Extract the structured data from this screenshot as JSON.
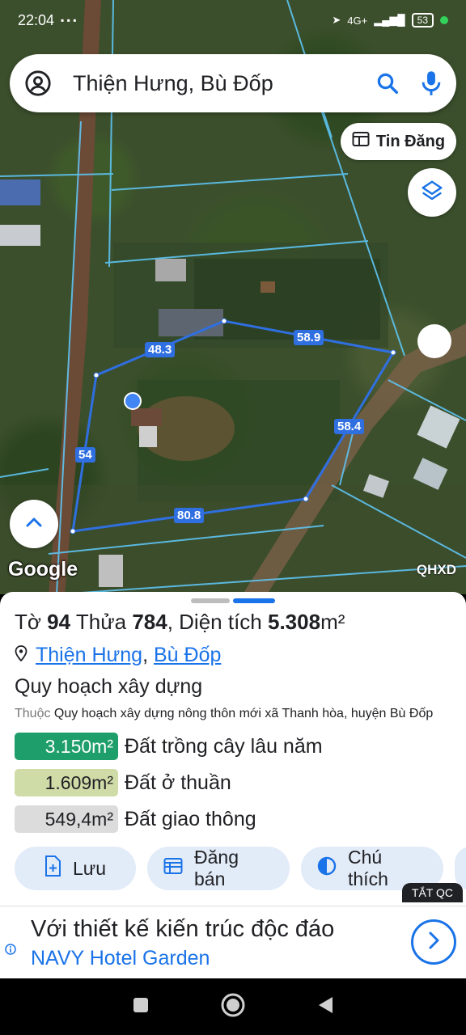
{
  "status_bar": {
    "time": "22:04",
    "network": "4G+",
    "battery": "53"
  },
  "search": {
    "query": "Thiện Hưng, Bù Đốp"
  },
  "map": {
    "tin_dang_label": "Tin Đăng",
    "edge_labels": [
      "48.3",
      "58.9",
      "58.4",
      "54",
      "80.8"
    ],
    "google_label": "Google",
    "layer_label": "QHXD"
  },
  "parcel": {
    "to_label": "Tờ",
    "to_value": "94",
    "thua_label": "Thửa",
    "thua_value": "784",
    "area_label": ", Diện tích",
    "area_value": "5.308",
    "area_unit": "m²",
    "location_commune": "Thiện Hưng",
    "location_sep": ",",
    "location_district": "Bù Đốp"
  },
  "planning": {
    "title": "Quy hoạch xây dựng",
    "prefix": "Thuộc",
    "description": "Quy hoạch xây dựng nông thôn mới xã Thanh hòa, huyện Bù Đốp"
  },
  "land_uses": [
    {
      "area": "3.150m²",
      "label": "Đất trồng cây lâu năm",
      "color": "#1e9e6a",
      "text_color": "#ffffff"
    },
    {
      "area": "1.609m²",
      "label": "Đất ở thuần",
      "color": "#cfdca8",
      "text_color": "#202124"
    },
    {
      "area": "549,4m²",
      "label": "Đất giao thông",
      "color": "#dcdcdc",
      "text_color": "#202124"
    }
  ],
  "actions": [
    {
      "label": "Lưu",
      "icon": "save-plus-icon"
    },
    {
      "label": "Đăng bán",
      "icon": "list-board-icon"
    },
    {
      "label": "Chú thích",
      "icon": "half-circle-icon"
    }
  ],
  "ad": {
    "close_label": "TẮT QC",
    "line1": "Với thiết kế kiến trúc độc đáo",
    "line2": "NAVY Hotel Garden"
  },
  "colors": {
    "accent": "#1a73e8",
    "parcel_line": "#2f6fe0"
  }
}
